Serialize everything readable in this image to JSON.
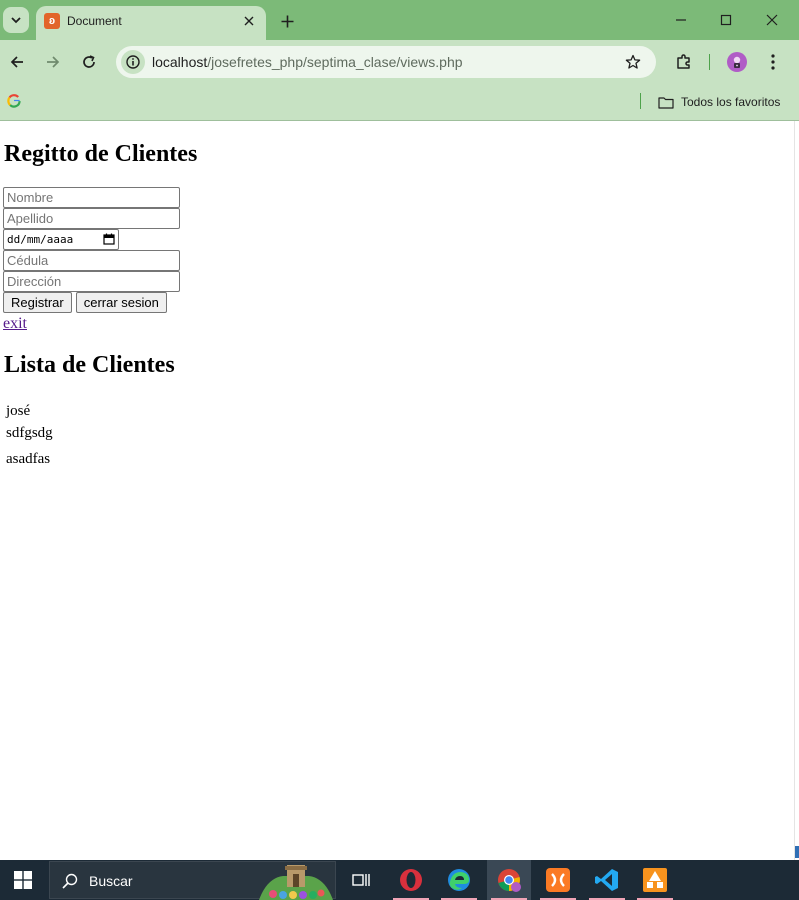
{
  "browser": {
    "tab_title": "Document",
    "url_host": "localhost",
    "url_path": "/josefretes_php/septima_clase/views.php",
    "bookmark_folder": "Todos los favoritos",
    "theme_color": "#7cba78"
  },
  "page": {
    "register_title": "Regitto de Clientes",
    "fields": {
      "nombre_placeholder": "Nombre",
      "apellido_placeholder": "Apellido",
      "date_placeholder": "dd/mm/aaaa",
      "cedula_placeholder": "Cédula",
      "direccion_placeholder": "Dirección"
    },
    "register_button": "Registrar",
    "logout_button": "cerrar sesion",
    "exit_link": "exit",
    "list_title": "Lista de Clientes",
    "clients": [
      "josé",
      "sdfgsdg",
      "asadfas"
    ]
  },
  "taskbar": {
    "search_label": "Buscar"
  }
}
